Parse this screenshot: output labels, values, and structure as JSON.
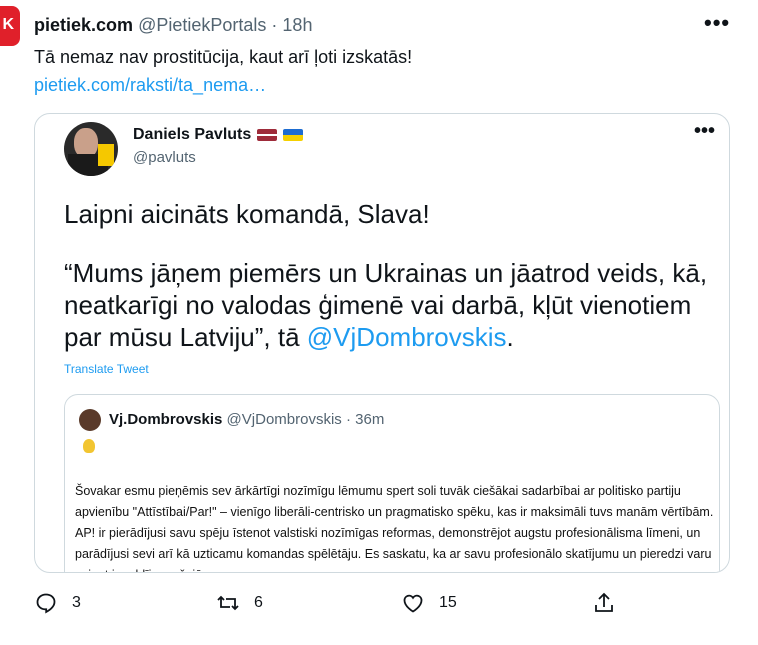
{
  "tweet": {
    "author_name": "pietiek.com",
    "author_handle": "@PietiekPortals",
    "separator": "·",
    "time": "18h",
    "text": "Tā nemaz nav prostitūcija, kaut arī ļoti izskatās!",
    "link": "pietiek.com/raksti/ta_nema…",
    "avatar_letter": "K"
  },
  "embedded": {
    "author_name": "Daniels Pavluts",
    "author_handle": "@pavluts",
    "paragraph1": "Laipni aicināts komandā, Slava!",
    "paragraph2": "“Mums jāņem piemērs un Ukrainas un jāatrod veids, kā, neatkarīgi no valodas ģimenē vai darbā, kļūt vienotiem par mūsu Latviju”, tā ",
    "mention": "@VjDombrovskis",
    "paragraph2_end": ".",
    "translate": "Translate Tweet",
    "quote": {
      "author_name": "Vj.Dombrovskis",
      "author_handle": "@VjDombrovskis",
      "separator": "·",
      "time": "36m",
      "text": "Šovakar esmu pieņēmis sev ārkārtīgi nozīmīgu lēmumu spert soli tuvāk ciešākai sadarbībai ar politisko partiju apvienību \"Attīstībai/Par!\" – vienīgo liberāli-centrisko un pragmatisko spēku, kas ir maksimāli tuvs manām vērtībām. AP! ir pierādījusi savu spēju īstenot valstiski nozīmīgas reformas, demonstrējot augstu profesionālisma līmeni, un parādījusi sevi arī kā uzticamu komandas spēlētāju. Es saskatu, ka ar savu profesionālo skatījumu un pieredzi varu sniegt ieguldījumu šajā"
    }
  },
  "actions": {
    "replies": "3",
    "retweets": "6",
    "likes": "15"
  },
  "colors": {
    "accent": "#1d9bf0",
    "muted": "#536471",
    "text": "#0f1419"
  }
}
